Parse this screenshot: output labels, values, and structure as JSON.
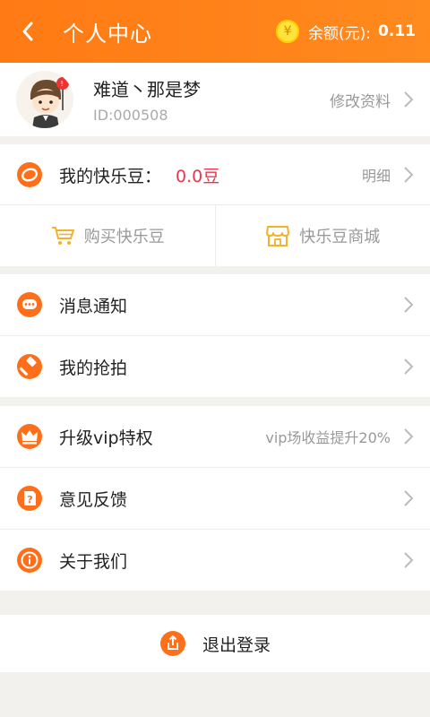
{
  "header": {
    "title": "个人中心",
    "balance_label": "余额(元):",
    "balance_value": "0.11",
    "coin_symbol": "¥",
    "color": "#ff7f18"
  },
  "profile": {
    "nickname": "难道丶那是梦",
    "id_text": "ID:000508",
    "edit_label": "修改资料"
  },
  "beans": {
    "label": "我的快乐豆：",
    "value": "0.0豆",
    "detail_label": "明细",
    "value_color": "#e8384f"
  },
  "bean_actions": {
    "buy_label": "购买快乐豆",
    "store_label": "快乐豆商城"
  },
  "menu_group_1": [
    {
      "label": "消息通知",
      "icon": "message-icon"
    },
    {
      "label": "我的抢拍",
      "icon": "auction-hammer-icon"
    }
  ],
  "menu_group_2": [
    {
      "label": "升级vip特权",
      "icon": "crown-icon",
      "note": "vip场收益提升20%"
    },
    {
      "label": "意见反馈",
      "icon": "feedback-icon"
    },
    {
      "label": "关于我们",
      "icon": "info-icon"
    }
  ],
  "logout": {
    "label": "退出登录",
    "icon": "logout-icon"
  },
  "colors": {
    "accent": "#ff7f18",
    "icon_orange": "#ff6f1a",
    "muted": "#999999",
    "bg": "#f2f1ee"
  }
}
